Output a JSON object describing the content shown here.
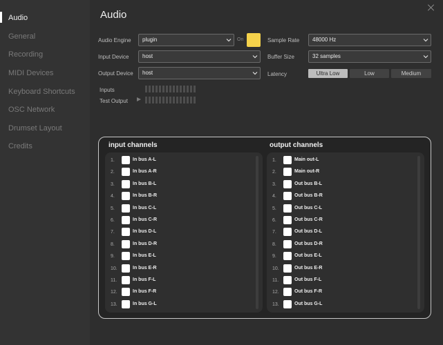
{
  "sidebar": {
    "items": [
      {
        "label": "Audio",
        "active": true
      },
      {
        "label": "General"
      },
      {
        "label": "Recording"
      },
      {
        "label": "MIDI Devices"
      },
      {
        "label": "Keyboard Shortcuts"
      },
      {
        "label": "OSC Network"
      },
      {
        "label": "Drumset Layout"
      },
      {
        "label": "Credits"
      }
    ]
  },
  "page": {
    "title": "Audio"
  },
  "settings": {
    "audio_engine": {
      "label": "Audio Engine",
      "value": "plugin",
      "on_label": "On",
      "toggle_color": "#f5d24b"
    },
    "input_device": {
      "label": "Input Device",
      "value": "host"
    },
    "output_device": {
      "label": "Output Device",
      "value": "host"
    },
    "sample_rate": {
      "label": "Sample Rate",
      "value": "48000 Hz"
    },
    "buffer_size": {
      "label": "Buffer Size",
      "value": "32 samples"
    },
    "latency": {
      "label": "Latency",
      "options": [
        "Ultra Low",
        "Low",
        "Medium"
      ],
      "selected": "Ultra Low"
    },
    "inputs_meter_label": "Inputs",
    "test_output_label": "Test Output"
  },
  "channels": {
    "input_title": "input channels",
    "output_title": "output channels",
    "input": [
      {
        "num": "1.",
        "name": "In bus A-L"
      },
      {
        "num": "2.",
        "name": "In bus A-R"
      },
      {
        "num": "3.",
        "name": "In bus B-L"
      },
      {
        "num": "4.",
        "name": "In bus B-R"
      },
      {
        "num": "5.",
        "name": "In bus C-L"
      },
      {
        "num": "6.",
        "name": "In bus C-R"
      },
      {
        "num": "7.",
        "name": "In bus D-L"
      },
      {
        "num": "8.",
        "name": "In bus D-R"
      },
      {
        "num": "9.",
        "name": "In bus E-L"
      },
      {
        "num": "10.",
        "name": "In bus E-R"
      },
      {
        "num": "11.",
        "name": "In bus F-L"
      },
      {
        "num": "12.",
        "name": "In bus F-R"
      },
      {
        "num": "13.",
        "name": "In bus G-L"
      }
    ],
    "output": [
      {
        "num": "1.",
        "name": "Main out-L"
      },
      {
        "num": "2.",
        "name": "Main out-R"
      },
      {
        "num": "3.",
        "name": "Out bus B-L"
      },
      {
        "num": "4.",
        "name": "Out bus B-R"
      },
      {
        "num": "5.",
        "name": "Out bus C-L"
      },
      {
        "num": "6.",
        "name": "Out bus C-R"
      },
      {
        "num": "7.",
        "name": "Out bus D-L"
      },
      {
        "num": "8.",
        "name": "Out bus D-R"
      },
      {
        "num": "9.",
        "name": "Out bus E-L"
      },
      {
        "num": "10.",
        "name": "Out bus E-R"
      },
      {
        "num": "11.",
        "name": "Out bus F-L"
      },
      {
        "num": "12.",
        "name": "Out bus F-R"
      },
      {
        "num": "13.",
        "name": "Out bus G-L"
      }
    ]
  }
}
